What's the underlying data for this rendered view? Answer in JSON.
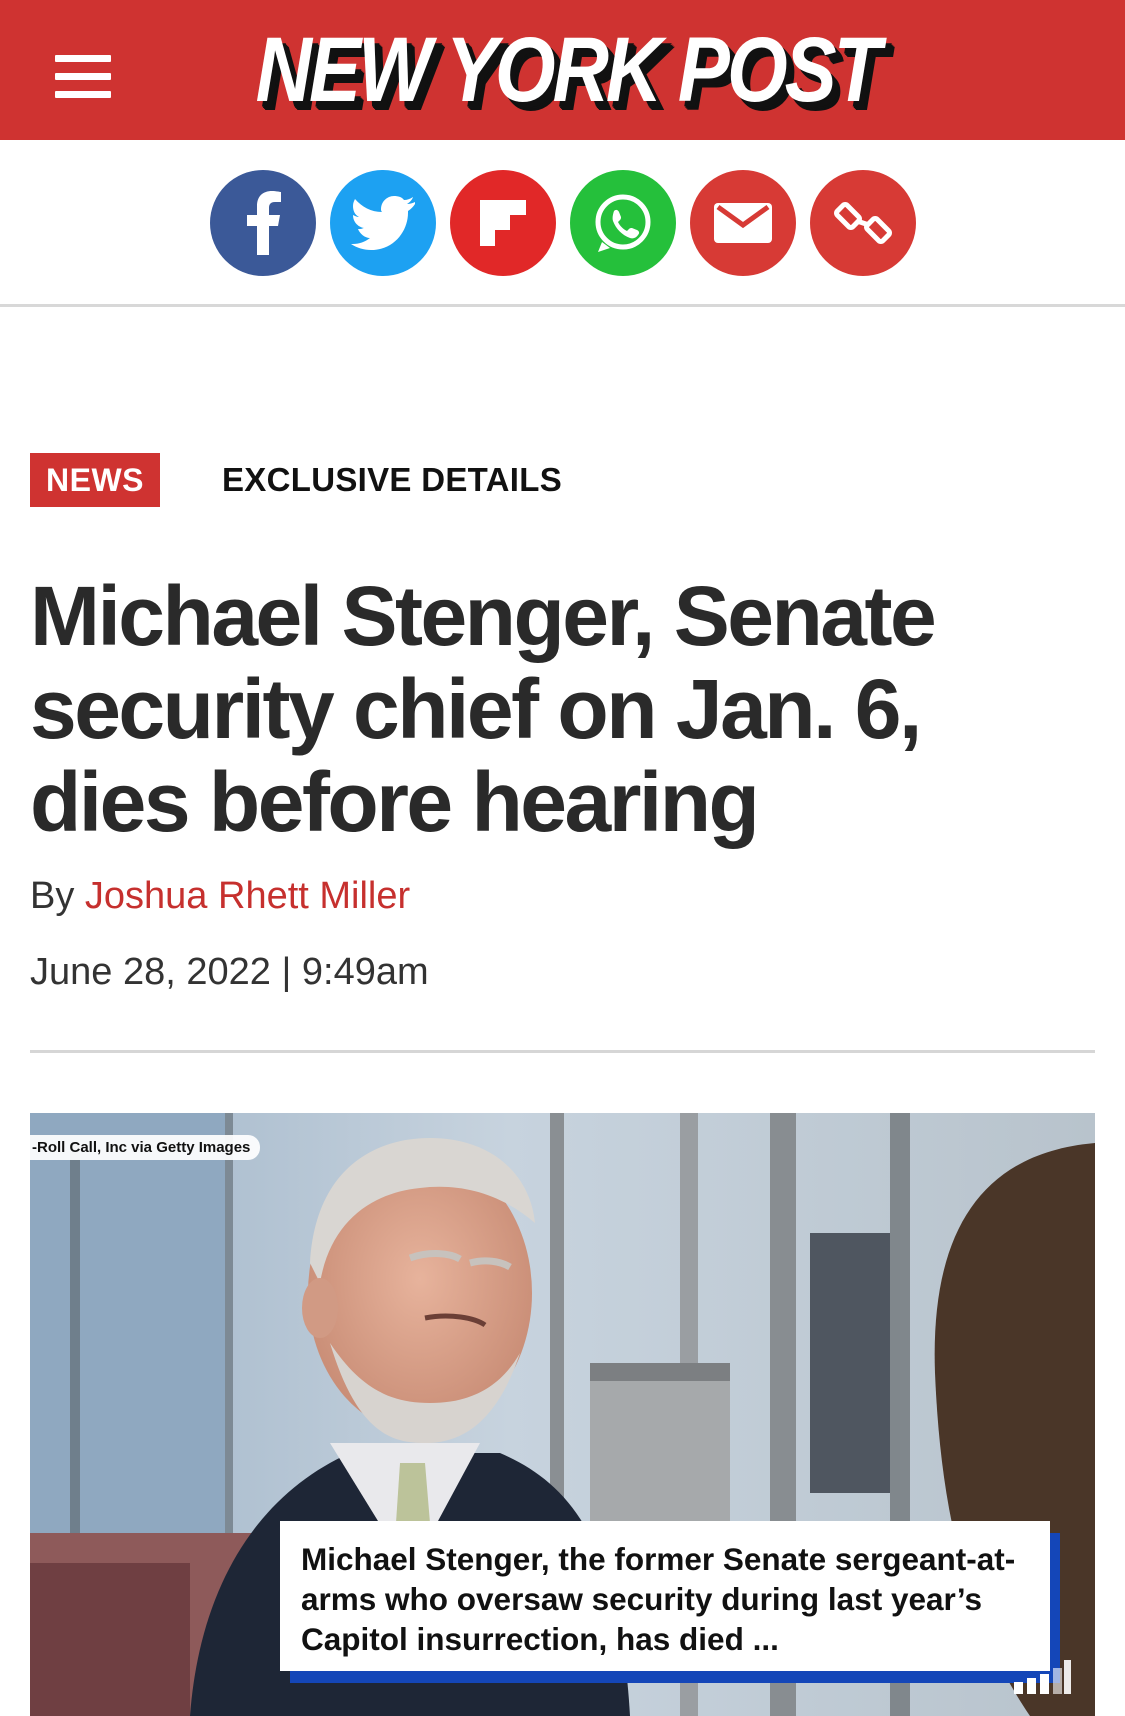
{
  "header": {
    "logo_text": "NEW YORK POST",
    "menu_icon": "hamburger-menu-icon",
    "brand_color": "#cf3331"
  },
  "share": [
    {
      "name": "facebook",
      "icon": "facebook-icon",
      "color": "#3b5998"
    },
    {
      "name": "twitter",
      "icon": "twitter-icon",
      "color": "#1da1f2"
    },
    {
      "name": "flipboard",
      "icon": "flipboard-icon",
      "color": "#e12828"
    },
    {
      "name": "whatsapp",
      "icon": "whatsapp-icon",
      "color": "#25c03b"
    },
    {
      "name": "email",
      "icon": "email-icon",
      "color": "#d73a35"
    },
    {
      "name": "copy-link",
      "icon": "link-icon",
      "color": "#d73a35"
    }
  ],
  "article": {
    "section": "NEWS",
    "tag": "EXCLUSIVE DETAILS",
    "headline": "Michael Stenger, Senate security chief on Jan. 6, dies before hearing",
    "by_prefix": "By ",
    "author": "Joshua Rhett Miller",
    "date": "June 28, 2022",
    "separator": " | ",
    "time": "9:49am"
  },
  "media": {
    "credit": "-Roll Call, Inc via Getty Images",
    "caption": "Michael Stenger, the former Senate sergeant-at-arms who oversaw security during last year’s Capitol insurrection, has died ...",
    "caption_accent": "#1446b8"
  }
}
